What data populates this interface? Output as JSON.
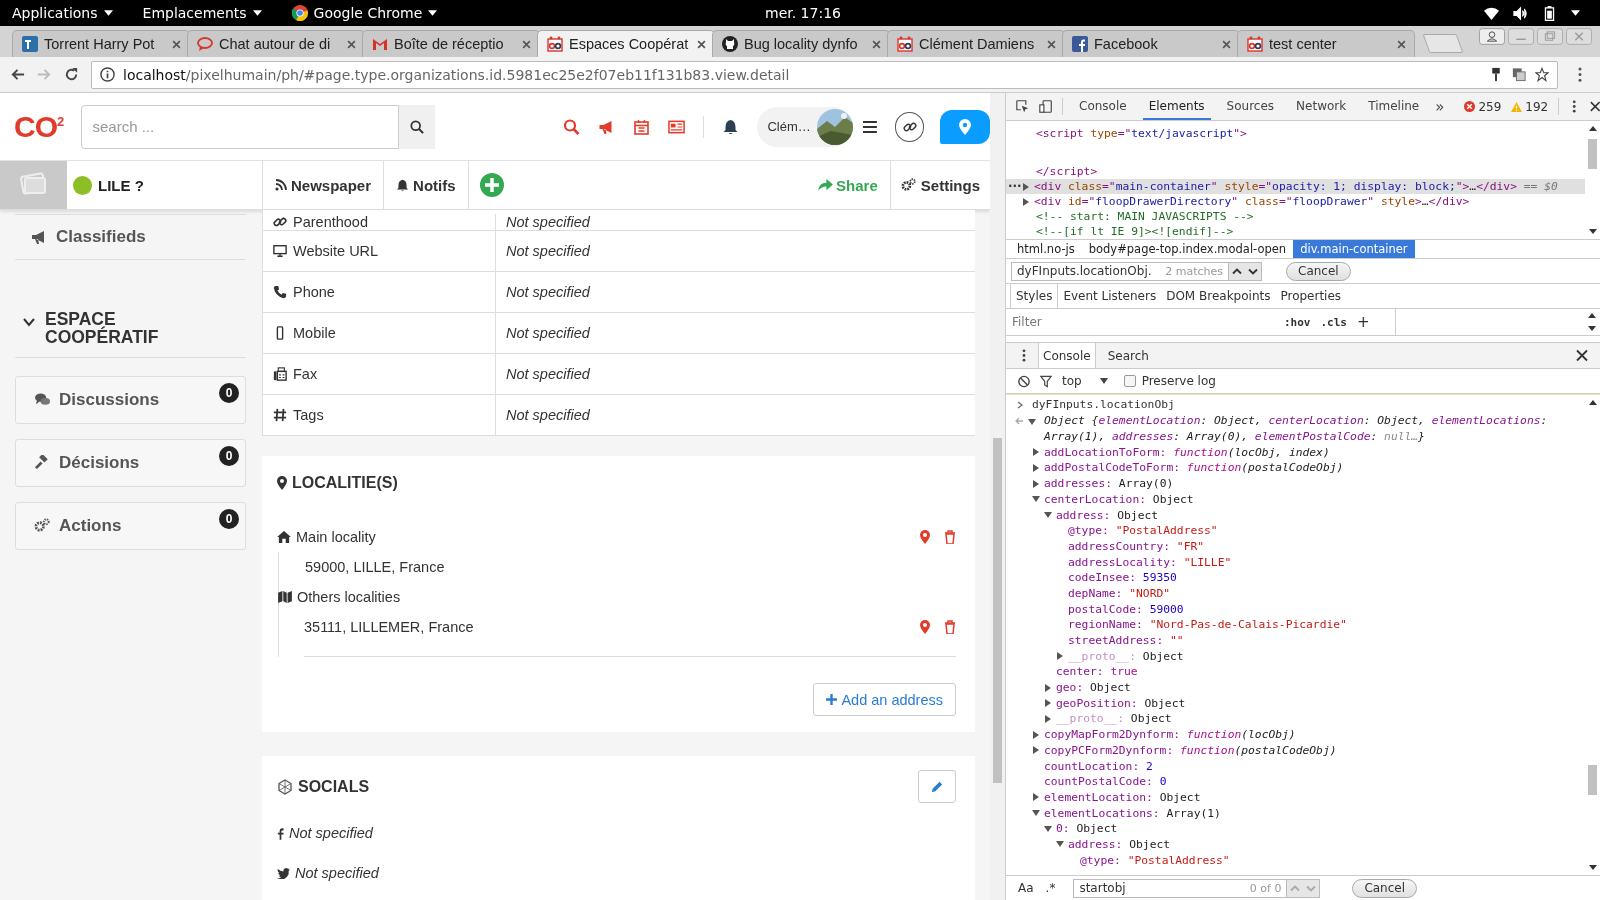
{
  "system_bar": {
    "menus": [
      {
        "label": "Applications"
      },
      {
        "label": "Emplacements"
      },
      {
        "label": "Google Chrome"
      }
    ],
    "clock": "mer. 17:16"
  },
  "browser_tabs": [
    {
      "title": "Torrent Harry Pot",
      "selected": false
    },
    {
      "title": "Chat autour de di",
      "selected": false
    },
    {
      "title": "Boîte de réceptio",
      "selected": false
    },
    {
      "title": "Espaces Coopérat",
      "selected": true
    },
    {
      "title": "Bug locality dynfo",
      "selected": false
    },
    {
      "title": "Clément Damiens",
      "selected": false
    },
    {
      "title": "Facebook",
      "selected": false
    },
    {
      "title": "test center",
      "selected": false
    }
  ],
  "address_bar": {
    "host": "localhost",
    "path": "/pixelhumain/ph/#page.type.organizations.id.5981ec25e2f07eb11f131b83.view.detail"
  },
  "site_header": {
    "logo": "CO$^{2}$",
    "search": {
      "placeholder": "search ..."
    },
    "user": {
      "name": "Clém…"
    }
  },
  "nav_bar": {
    "name": "LILE ?",
    "items": [
      {
        "label": "Newspaper"
      },
      {
        "label": "Notifs"
      }
    ],
    "share": "Share",
    "settings": "Settings"
  },
  "sidebar": {
    "items": [
      {
        "label": "Classifieds"
      }
    ],
    "section": {
      "title": "ESPACE COOPÉRATIF",
      "expanded": true,
      "cards": [
        {
          "label": "Discussions",
          "count": "0"
        },
        {
          "label": "Décisions",
          "count": "0"
        },
        {
          "label": "Actions",
          "count": "0"
        }
      ]
    }
  },
  "details_table": {
    "rows": [
      {
        "label": "Parenthood",
        "value": "Not specified"
      },
      {
        "label": "Website URL",
        "value": "Not specified"
      },
      {
        "label": "Phone",
        "value": "Not specified"
      },
      {
        "label": "Mobile",
        "value": "Not specified"
      },
      {
        "label": "Fax",
        "value": "Not specified"
      },
      {
        "label": "Tags",
        "value": "Not specified"
      }
    ]
  },
  "localities": {
    "title": "LOCALITIE(S)",
    "main_label": "Main locality",
    "main_address": "59000, LILLE, France",
    "others_label": "Others localities",
    "others": [
      "35111, LILLEMER, France"
    ],
    "add_button": "Add an address"
  },
  "socials": {
    "title": "SOCIALS",
    "links": [
      {
        "value": "Not specified"
      },
      {
        "value": "Not specified"
      }
    ]
  },
  "devtools": {
    "tabs": [
      {
        "label": "Console",
        "selected": false
      },
      {
        "label": "Elements",
        "selected": true
      },
      {
        "label": "Sources",
        "selected": false
      },
      {
        "label": "Network",
        "selected": false
      },
      {
        "label": "Timeline",
        "selected": false
      }
    ],
    "more": "»",
    "errors": "259",
    "warnings": "192",
    "dom_lines": [
      {
        "kind": "code",
        "selected": false,
        "segments": [
          {
            "kind": "tag",
            "text": "<script "
          },
          {
            "kind": "attr",
            "text": "type"
          },
          {
            "kind": "tag",
            "text": "=\""
          },
          {
            "kind": "value",
            "text": "text/javascript"
          },
          {
            "kind": "tag",
            "text": "\">"
          }
        ]
      },
      {
        "kind": "blank"
      },
      {
        "kind": "code",
        "selected": false,
        "segments": [
          {
            "kind": "tag",
            "text": "</script>"
          }
        ]
      },
      {
        "kind": "code",
        "expanded": false,
        "selected": true,
        "gutter": "···",
        "segments": [
          {
            "kind": "tag",
            "text": "<div "
          },
          {
            "kind": "attr",
            "text": "class"
          },
          {
            "kind": "tag",
            "text": "=\""
          },
          {
            "kind": "value",
            "text": "main-container"
          },
          {
            "kind": "tag",
            "text": "\" "
          },
          {
            "kind": "attr",
            "text": "style"
          },
          {
            "kind": "tag",
            "text": "=\""
          },
          {
            "kind": "value",
            "text": "opacity: 1; display: block;"
          },
          {
            "kind": "tag",
            "text": "\">"
          },
          {
            "kind": "plain",
            "text": "…"
          },
          {
            "kind": "tag",
            "text": "</div>"
          },
          {
            "kind": "ref",
            "text": " == $0"
          }
        ]
      },
      {
        "kind": "code",
        "expanded": false,
        "selected": false,
        "segments": [
          {
            "kind": "tag",
            "text": "<div "
          },
          {
            "kind": "attr",
            "text": "id"
          },
          {
            "kind": "tag",
            "text": "=\""
          },
          {
            "kind": "value",
            "text": "floopDrawerDirectory"
          },
          {
            "kind": "tag",
            "text": "\" "
          },
          {
            "kind": "attr",
            "text": "class"
          },
          {
            "kind": "tag",
            "text": "=\""
          },
          {
            "kind": "value",
            "text": "floopDrawer"
          },
          {
            "kind": "tag",
            "text": "\" "
          },
          {
            "kind": "attr",
            "text": "style"
          },
          {
            "kind": "tag",
            "text": ">"
          },
          {
            "kind": "plain",
            "text": "…"
          },
          {
            "kind": "tag",
            "text": "</div>"
          }
        ]
      },
      {
        "kind": "code",
        "selected": false,
        "segments": [
          {
            "kind": "comment",
            "text": "<!-- start: MAIN JAVASCRIPTS -->"
          }
        ]
      },
      {
        "kind": "code",
        "selected": false,
        "segments": [
          {
            "kind": "comment",
            "text": "<!--[if lt IE 9]><![endif]-->"
          }
        ]
      }
    ],
    "breadcrumbs": [
      {
        "label": "html.no-js",
        "selected": false
      },
      {
        "label": "body#page-top.index.modal-open",
        "selected": false
      },
      {
        "label": "div.main-container",
        "selected": true
      }
    ],
    "find": {
      "value": "dyFInputs.locationObj.",
      "matches": "2 matches",
      "cancel": "Cancel"
    },
    "panel_tabs": [
      {
        "label": "Styles",
        "selected": true
      },
      {
        "label": "Event Listeners",
        "selected": false
      },
      {
        "label": "DOM Breakpoints",
        "selected": false
      },
      {
        "label": "Properties",
        "selected": false
      }
    ],
    "styles_filter": {
      "placeholder": "Filter",
      "hov": ":hov",
      "cls": ".cls",
      "add": "+"
    },
    "drawer_tabs": [
      {
        "label": "Console",
        "selected": true
      },
      {
        "label": "Search",
        "selected": false
      }
    ],
    "console_toolbar": {
      "context": "top",
      "preserve_log": {
        "label": "Preserve log",
        "checked": false
      }
    },
    "console": {
      "input": "dyFInputs.locationObj",
      "summary": [
        {
          "kind": "plain",
          "text": "Object {"
        },
        {
          "kind": "key",
          "text": "elementLocation"
        },
        {
          "kind": "plain",
          "text": ": Object, "
        },
        {
          "kind": "key",
          "text": "centerLocation"
        },
        {
          "kind": "plain",
          "text": ": Object, "
        },
        {
          "kind": "key",
          "text": "elementLocations"
        },
        {
          "kind": "plain",
          "text": ": Array(1), "
        },
        {
          "kind": "key",
          "text": "addresses"
        },
        {
          "kind": "plain",
          "text": ": Array(0), "
        },
        {
          "kind": "key",
          "text": "elementPostalCode"
        },
        {
          "kind": "plain",
          "text": ": "
        },
        {
          "kind": "null",
          "text": "null…"
        },
        {
          "kind": "plain",
          "text": "}"
        }
      ],
      "tree": [
        {
          "kind": "function",
          "key": "addLocationToForm:",
          "value": "function",
          "args": "(locObj, index)",
          "expanded": false
        },
        {
          "kind": "function",
          "key": "addPostalCodeToForm:",
          "value": "function",
          "args": "(postalCodeObj)",
          "expanded": false
        },
        {
          "kind": "object",
          "key": "addresses:",
          "value": "Array(0)",
          "expanded": false
        },
        {
          "kind": "object",
          "key": "centerLocation:",
          "value": "Object",
          "expanded": true,
          "children": [
            {
              "kind": "object",
              "key": "address:",
              "value": "Object",
              "expanded": true,
              "children": [
                {
                  "kind": "string",
                  "key": "@type:",
                  "value": "\"PostalAddress\""
                },
                {
                  "kind": "string",
                  "key": "addressCountry:",
                  "value": "\"FR\""
                },
                {
                  "kind": "string",
                  "key": "addressLocality:",
                  "value": "\"LILLE\""
                },
                {
                  "kind": "number",
                  "key": "codeInsee:",
                  "value": "59350"
                },
                {
                  "kind": "string",
                  "key": "depName:",
                  "value": "\"NORD\""
                },
                {
                  "kind": "number",
                  "key": "postalCode:",
                  "value": "59000"
                },
                {
                  "kind": "string",
                  "key": "regionName:",
                  "value": "\"Nord-Pas-de-Calais-Picardie\""
                },
                {
                  "kind": "string",
                  "key": "streetAddress:",
                  "value": "\"\""
                },
                {
                  "kind": "proto",
                  "key": "__proto__:",
                  "value": "Object",
                  "expanded": false
                }
              ]
            },
            {
              "kind": "bool",
              "key": "center:",
              "value": "true"
            },
            {
              "kind": "object",
              "key": "geo:",
              "value": "Object",
              "expanded": false
            },
            {
              "kind": "object",
              "key": "geoPosition:",
              "value": "Object",
              "expanded": false
            },
            {
              "kind": "proto",
              "key": "__proto__:",
              "value": "Object",
              "expanded": false
            }
          ]
        },
        {
          "kind": "function",
          "key": "copyMapForm2Dynform:",
          "value": "function",
          "args": "(locObj)",
          "expanded": false
        },
        {
          "kind": "function",
          "key": "copyPCForm2Dynform:",
          "value": "function",
          "args": "(postalCodeObj)",
          "expanded": false
        },
        {
          "kind": "number",
          "key": "countLocation:",
          "value": "2"
        },
        {
          "kind": "number",
          "key": "countPostalCode:",
          "value": "0"
        },
        {
          "kind": "object",
          "key": "elementLocation:",
          "value": "Object",
          "expanded": false
        },
        {
          "kind": "object",
          "key": "elementLocations:",
          "value": "Array(1)",
          "expanded": true,
          "children": [
            {
              "kind": "object",
              "key": "0:",
              "value": "Object",
              "expanded": true,
              "children": [
                {
                  "kind": "object",
                  "key": "address:",
                  "value": "Object",
                  "expanded": true,
                  "children": [
                    {
                      "kind": "string",
                      "key": "@type:",
                      "value": "\"PostalAddress\""
                    }
                  ]
                }
              ]
            }
          ]
        }
      ]
    },
    "bottom_search": {
      "case": "Aa",
      "regex": ".*",
      "value": "startobj",
      "count": "0 of 0",
      "cancel": "Cancel"
    }
  }
}
